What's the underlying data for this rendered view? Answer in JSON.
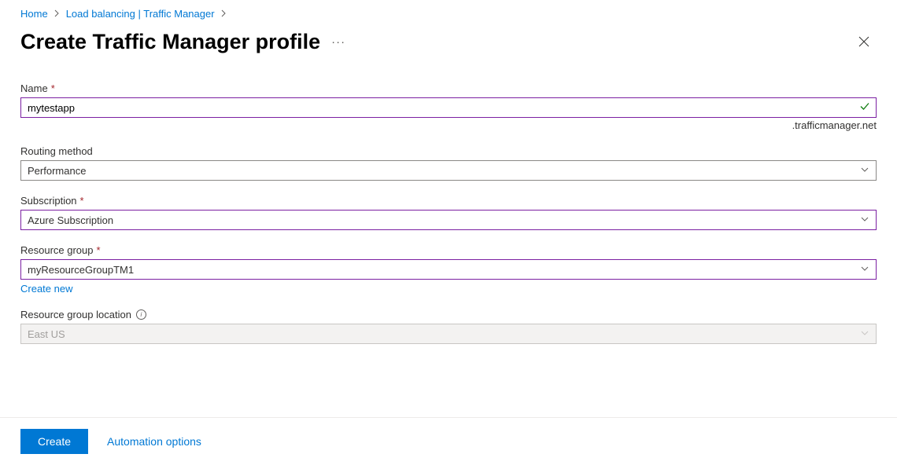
{
  "breadcrumb": {
    "home": "Home",
    "level2": "Load balancing | Traffic Manager"
  },
  "header": {
    "title": "Create Traffic Manager profile"
  },
  "form": {
    "name": {
      "label": "Name",
      "value": "mytestapp",
      "suffix": ".trafficmanager.net"
    },
    "routing": {
      "label": "Routing method",
      "value": "Performance"
    },
    "subscription": {
      "label": "Subscription",
      "value": "Azure Subscription"
    },
    "resourceGroup": {
      "label": "Resource group",
      "value": "myResourceGroupTM1",
      "createNew": "Create new"
    },
    "location": {
      "label": "Resource group location",
      "value": "East US"
    }
  },
  "footer": {
    "create": "Create",
    "automation": "Automation options"
  }
}
